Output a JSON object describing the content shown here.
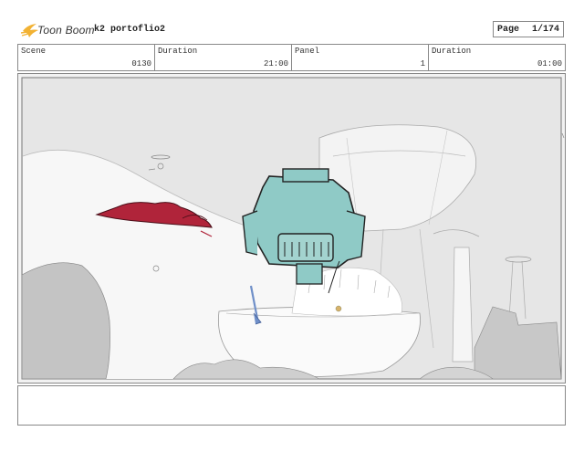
{
  "header": {
    "brand": "Toon Boom",
    "project_name": "k2 portoflio2",
    "page_label": "Page",
    "page_value": "1/174"
  },
  "info_bar": {
    "scene_label": "Scene",
    "scene_value": "0130",
    "duration_label": "Duration",
    "duration_value": "21:00",
    "panel_label": "Panel",
    "panel_value": "1",
    "panel_duration_label": "Duration",
    "panel_duration_value": "01:00"
  },
  "colors": {
    "logo_accent": "#f2b233",
    "robot_teal": "#8fcac6",
    "red_ship": "#b0243a",
    "figure_blue": "#6f8fc8",
    "sky": "#e4e4e4"
  },
  "icons": {
    "logo": "toon-boom-star-logo"
  }
}
